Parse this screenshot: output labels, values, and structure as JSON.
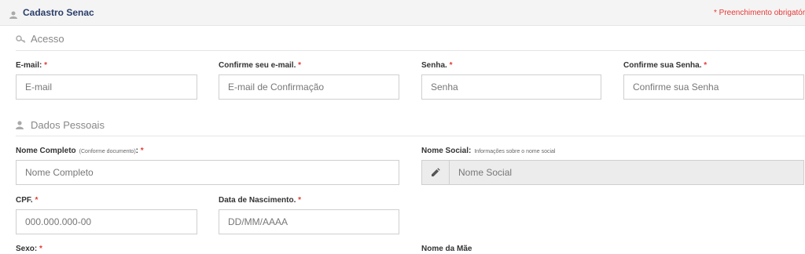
{
  "header": {
    "title": "Cadastro Senac",
    "required_note": "* Preenchimento obrigatório"
  },
  "sections": {
    "access": {
      "title": "Acesso",
      "icon": "key-icon"
    },
    "personal": {
      "title": "Dados Pessoais",
      "icon": "user-icon"
    }
  },
  "fields": {
    "email": {
      "label": "E-mail:",
      "required": "*",
      "placeholder": "E-mail"
    },
    "confirm_email": {
      "label": "Confirme seu e-mail.",
      "required": "*",
      "placeholder": "E-mail de Confirmação"
    },
    "password": {
      "label": "Senha.",
      "required": "*",
      "placeholder": "Senha"
    },
    "confirm_password": {
      "label": "Confirme sua Senha.",
      "required": "*",
      "placeholder": "Confirme sua Senha"
    },
    "full_name": {
      "label": "Nome Completo",
      "hint": "(Conforme documento)",
      "suffix": ":",
      "required": "*",
      "placeholder": "Nome Completo"
    },
    "social_name": {
      "label": "Nome Social:",
      "hint": "Informações sobre o nome social",
      "placeholder": "Nome Social",
      "icon": "edit-icon"
    },
    "cpf": {
      "label": "CPF.",
      "required": "*",
      "placeholder": "000.000.000-00"
    },
    "birth_date": {
      "label": "Data de Nascimento.",
      "required": "*",
      "placeholder": "DD/MM/AAAA"
    },
    "sex": {
      "label": "Sexo:",
      "required": "*"
    },
    "mother_name": {
      "label": "Nome da Mãe"
    }
  },
  "colors": {
    "accent": "#2b3f6b",
    "required": "#e53935"
  }
}
